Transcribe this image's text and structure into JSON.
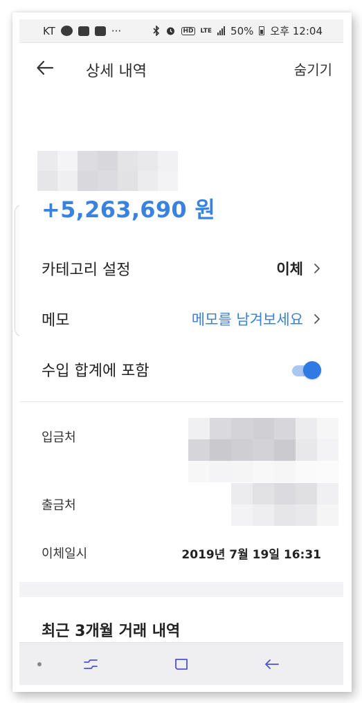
{
  "status_bar": {
    "carrier": "KT",
    "more": "···",
    "hd": "HD",
    "lte": "LTE",
    "battery": "50%",
    "time": "오후 12:04",
    "icons": [
      "band-icon",
      "gallery-icon",
      "app-icon",
      "bluetooth-icon",
      "alarm-icon",
      "hd-icon",
      "lte-icon",
      "signal-icon",
      "battery-icon"
    ]
  },
  "header": {
    "title": "상세 내역",
    "hide_label": "숨기기",
    "back_icon": "arrow-left-icon"
  },
  "amount": "+5,263,690 원",
  "rows": {
    "category": {
      "label": "카테고리 설정",
      "value": "이체"
    },
    "memo": {
      "label": "메모",
      "value": "메모를 남겨보세요"
    },
    "income": {
      "label": "수입 합계에 포함",
      "toggle_on": true
    }
  },
  "details": {
    "deposit_from": {
      "label": "입금처"
    },
    "withdraw_to": {
      "label": "출금처"
    },
    "transfer_date": {
      "label": "이체일시",
      "value": "2019년 7월 19일 16:31"
    }
  },
  "recent": {
    "title": "최근 3개월 거래 내역"
  },
  "nav": {
    "icons": [
      "nav-dot-icon",
      "recent-apps-icon",
      "home-icon",
      "back-icon"
    ]
  },
  "colors": {
    "accent": "#3a82e0",
    "link": "#3a7fd8",
    "toggle_on": "#2f7ae3",
    "nav_icon": "#4d52d8"
  }
}
